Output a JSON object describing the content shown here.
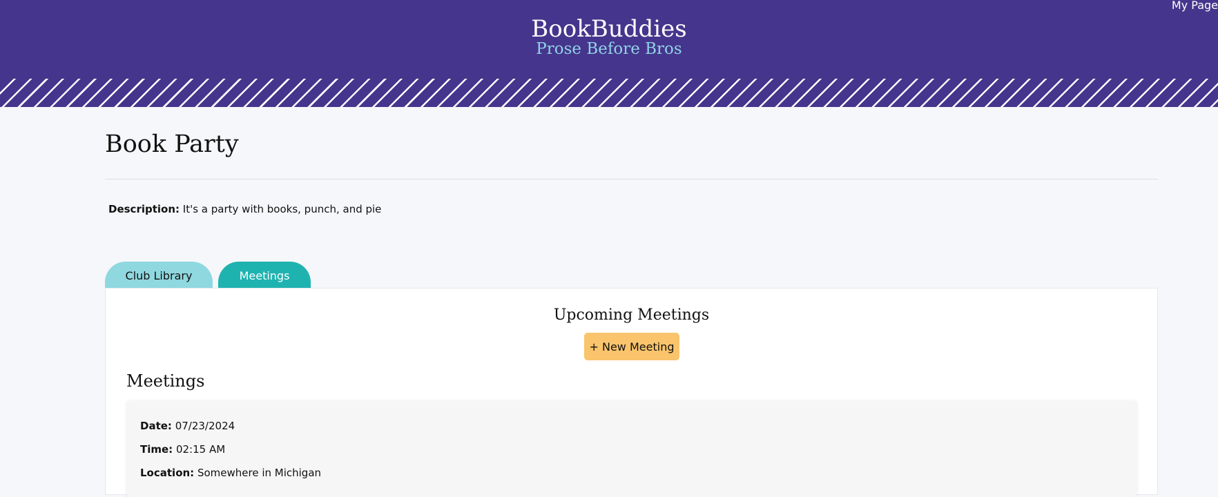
{
  "header": {
    "brand": "BookBuddies",
    "tagline": "Prose Before Bros",
    "my_page_link": "My Page"
  },
  "club": {
    "title": "Book Party",
    "description_label": "Description:",
    "description": "It's a party with books, punch, and pie"
  },
  "tabs": [
    {
      "label": "Club Library",
      "active": false
    },
    {
      "label": "Meetings",
      "active": true
    }
  ],
  "meetings_panel": {
    "heading": "Upcoming Meetings",
    "new_meeting_label": "+ New Meeting",
    "list_heading": "Meetings",
    "items": [
      {
        "date_label": "Date:",
        "date": "07/23/2024",
        "time_label": "Time:",
        "time": "02:15 AM",
        "location_label": "Location:",
        "location": "Somewhere in Michigan"
      }
    ]
  },
  "colors": {
    "header_bg": "#46358c",
    "tagline": "#8fd3e6",
    "tab_inactive": "#8fd8e0",
    "tab_active": "#1fb3b0",
    "button_accent": "#f9c46b"
  }
}
